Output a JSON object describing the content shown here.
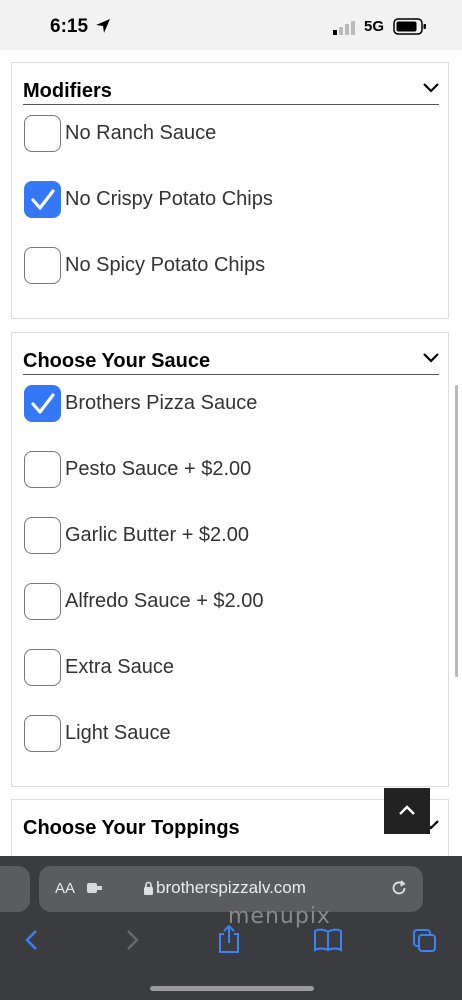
{
  "status_bar": {
    "time": "6:15",
    "network": "5G"
  },
  "groups": [
    {
      "title": "Modifiers",
      "options": [
        {
          "label": "No Ranch Sauce",
          "checked": false
        },
        {
          "label": "No Crispy Potato Chips",
          "checked": true
        },
        {
          "label": "No Spicy Potato Chips",
          "checked": false
        }
      ]
    },
    {
      "title": "Choose Your Sauce",
      "options": [
        {
          "label": "Brothers Pizza Sauce",
          "checked": true
        },
        {
          "label": "Pesto Sauce + $2.00",
          "checked": false
        },
        {
          "label": "Garlic Butter + $2.00",
          "checked": false
        },
        {
          "label": "Alfredo Sauce + $2.00",
          "checked": false
        },
        {
          "label": "Extra Sauce",
          "checked": false
        },
        {
          "label": "Light Sauce",
          "checked": false
        }
      ]
    },
    {
      "title": "Choose Your Toppings",
      "options": []
    }
  ],
  "browser": {
    "text_size_label": "AA",
    "url": "brotherspizzalv.com",
    "watermark": "menupix"
  },
  "colors": {
    "accent": "#3478f6",
    "browser_bar": "#3b3c40"
  },
  "icons": [
    "location-arrow-icon",
    "signal-icon",
    "battery-icon",
    "chevron-down-icon",
    "checkmark-icon",
    "chevron-up-icon",
    "lock-icon",
    "reload-icon",
    "back-icon",
    "forward-icon",
    "share-icon",
    "bookmarks-icon",
    "tabs-icon"
  ]
}
